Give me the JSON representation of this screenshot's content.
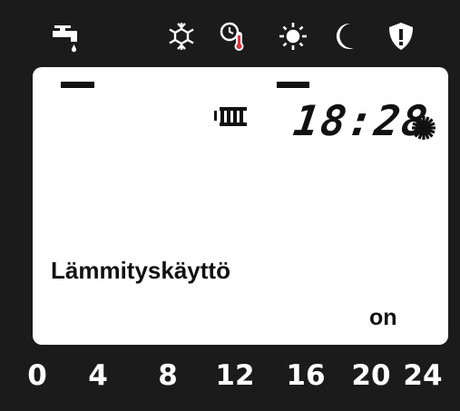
{
  "display": {
    "clock": "18:28",
    "mode_label": "Lämmityskäyttö",
    "status_label": "on"
  },
  "top_icons": [
    "faucet-icon",
    "snowflake-icon",
    "clock-thermometer-icon",
    "sun-icon",
    "moon-icon",
    "shield-exclamation-icon"
  ],
  "active_markers": [
    "faucet",
    "sun"
  ],
  "hour_scale": [
    "0",
    "4",
    "8",
    "12",
    "16",
    "20",
    "24"
  ],
  "colors": {
    "background": "#1b1b1b",
    "screen": "#ffffff",
    "ink": "#111111"
  }
}
